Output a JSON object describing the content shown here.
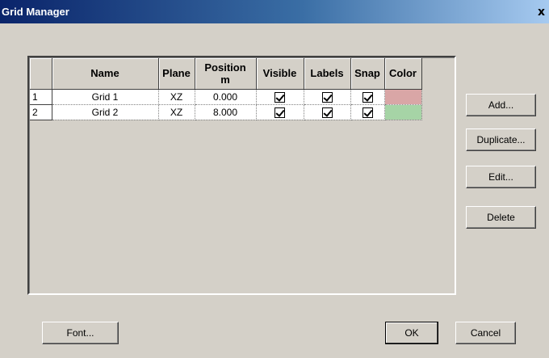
{
  "window": {
    "title": "Grid Manager",
    "close_glyph": "x"
  },
  "table": {
    "columns": [
      "Name",
      "Plane",
      "Position\nm",
      "Visible",
      "Labels",
      "Snap",
      "Color"
    ],
    "rows": [
      {
        "num": "1",
        "name": "Grid 1",
        "plane": "XZ",
        "position": "0.000",
        "visible": true,
        "labels": true,
        "snap": true,
        "color": "#d9a6a6"
      },
      {
        "num": "2",
        "name": "Grid 2",
        "plane": "XZ",
        "position": "8.000",
        "visible": true,
        "labels": true,
        "snap": true,
        "color": "#a6d4a6"
      }
    ]
  },
  "buttons": {
    "add": "Add...",
    "duplicate": "Duplicate...",
    "edit": "Edit...",
    "delete": "Delete",
    "font": "Font...",
    "ok": "OK",
    "cancel": "Cancel"
  }
}
